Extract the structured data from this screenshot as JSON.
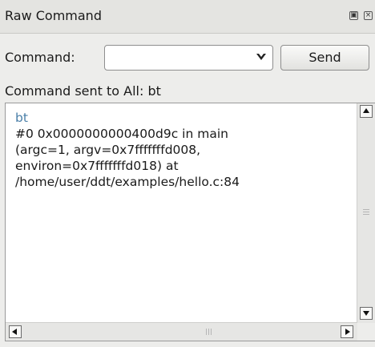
{
  "window": {
    "title": "Raw Command",
    "float_icon": "float-icon",
    "close_icon": "close-icon"
  },
  "command": {
    "label": "Command:",
    "value": "",
    "placeholder": "",
    "send_label": "Send"
  },
  "status_text": "Command sent to All: bt",
  "output": {
    "echo": "bt",
    "lines": [
      "#0  0x0000000000400d9c in main",
      "(argc=1, argv=0x7fffffffd008,",
      "environ=0x7fffffffd018) at",
      "/home/user/ddt/examples/hello.c:84"
    ]
  },
  "colors": {
    "echo_text": "#4a7fa8",
    "background": "#ededeb"
  }
}
